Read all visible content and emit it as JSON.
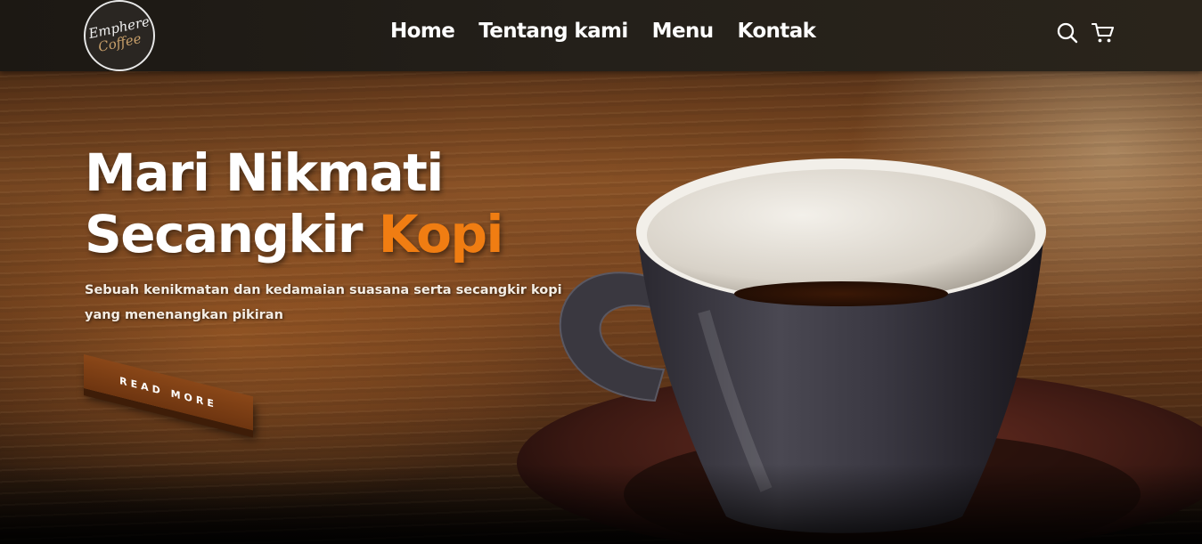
{
  "brand": {
    "line1": "Emphere",
    "line2": "Coffee"
  },
  "nav": {
    "links": [
      {
        "label": "Home"
      },
      {
        "label": "Tentang kami"
      },
      {
        "label": "Menu"
      },
      {
        "label": "Kontak"
      }
    ],
    "icons": [
      "search-icon",
      "shopping-cart-icon"
    ]
  },
  "hero": {
    "title_line1": "Mari Nikmati",
    "title_line2_prefix": "Secangkir ",
    "title_accent": "Kopi",
    "subtitle": "Sebuah kenikmatan dan kedamaian suasana serta secangkir kopi yang menenangkan pikiran",
    "cta_label": "READ MORE"
  },
  "colors": {
    "accent": "#f07d12",
    "navbar": "#24201a",
    "button": "#7a3d14",
    "text": "#ffffff"
  }
}
